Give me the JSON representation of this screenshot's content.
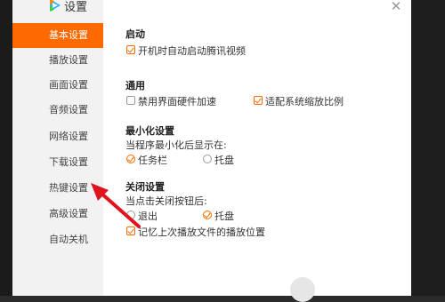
{
  "app": {
    "title": "设置",
    "logo": "tencent-video-logo"
  },
  "sidebar": {
    "items": [
      {
        "label": "基本设置",
        "active": true
      },
      {
        "label": "播放设置",
        "active": false
      },
      {
        "label": "画面设置",
        "active": false
      },
      {
        "label": "音频设置",
        "active": false
      },
      {
        "label": "网络设置",
        "active": false
      },
      {
        "label": "下载设置",
        "active": false
      },
      {
        "label": "热键设置",
        "active": false
      },
      {
        "label": "高级设置",
        "active": false
      },
      {
        "label": "自动关机",
        "active": false
      }
    ]
  },
  "close_icon": "close-icon",
  "sections": {
    "startup": {
      "title": "启动",
      "autostart": {
        "label": "开机时自动启动腾讯视频",
        "checked": true
      }
    },
    "general": {
      "title": "通用",
      "disable_hw": {
        "label": "禁用界面硬件加速",
        "checked": false
      },
      "system_scale": {
        "label": "适配系统缩放比例",
        "checked": true
      }
    },
    "minimize": {
      "title": "最小化设置",
      "prompt": "当程序最小化后显示在:",
      "options": [
        {
          "label": "任务栏",
          "checked": true
        },
        {
          "label": "托盘",
          "checked": false
        }
      ]
    },
    "close": {
      "title": "关闭设置",
      "prompt": "当点击关闭按钮后:",
      "options": [
        {
          "label": "退出",
          "checked": false
        },
        {
          "label": "托盘",
          "checked": true
        }
      ],
      "remember": {
        "label": "记忆上次播放文件的播放位置",
        "checked": true
      }
    }
  },
  "colors": {
    "accent": "#ff6a00",
    "annotation_arrow": "#e0141e"
  }
}
